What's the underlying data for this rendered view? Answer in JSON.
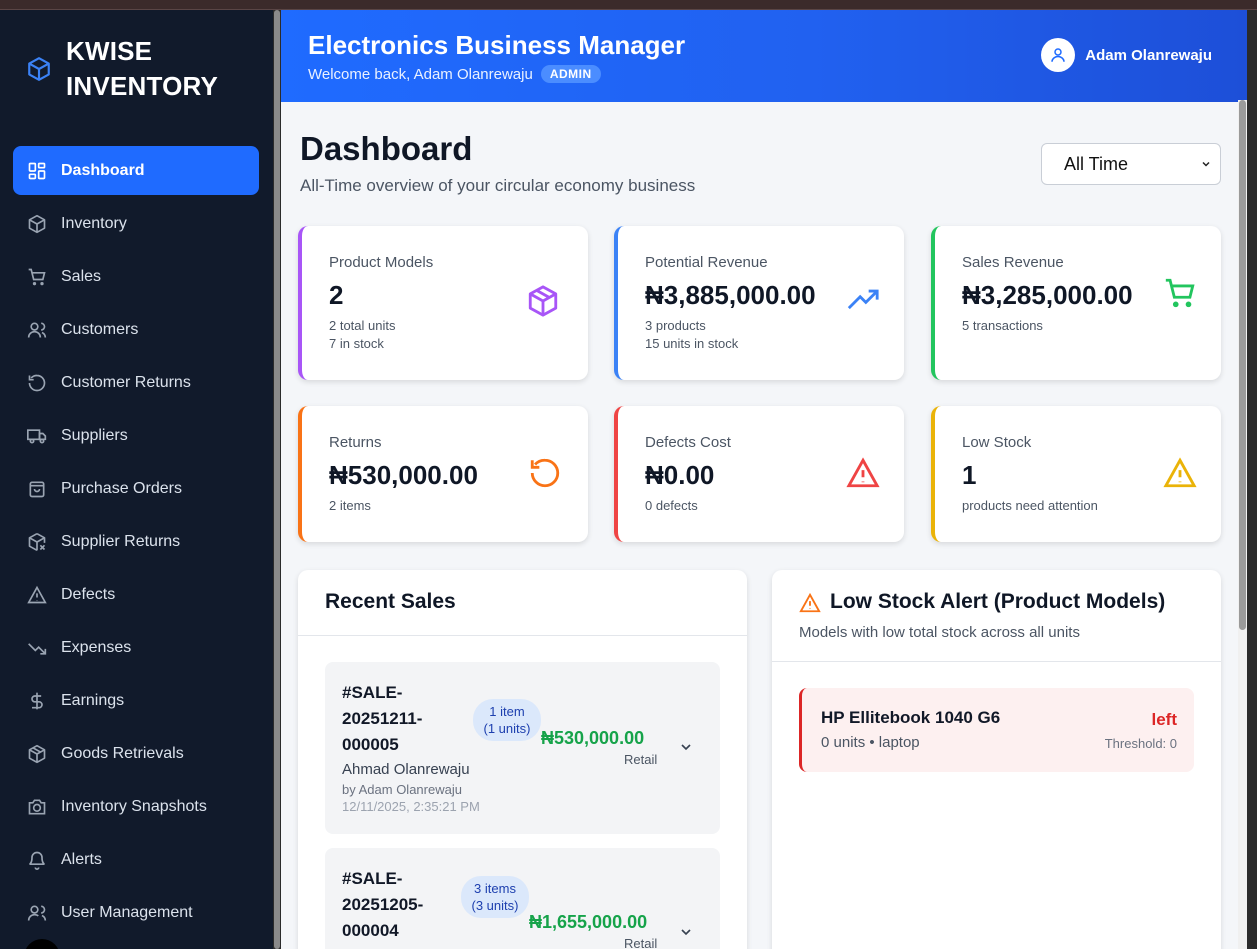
{
  "brand": {
    "name": "KWISE INVENTORY"
  },
  "sidebar": {
    "items": [
      {
        "label": "Dashboard",
        "icon": "dashboard-icon",
        "active": true
      },
      {
        "label": "Inventory",
        "icon": "package-icon"
      },
      {
        "label": "Sales",
        "icon": "cart-icon"
      },
      {
        "label": "Customers",
        "icon": "users-icon"
      },
      {
        "label": "Customer Returns",
        "icon": "rotate-ccw-icon"
      },
      {
        "label": "Suppliers",
        "icon": "truck-icon"
      },
      {
        "label": "Purchase Orders",
        "icon": "shopping-bag-icon"
      },
      {
        "label": "Supplier Returns",
        "icon": "package-x-icon"
      },
      {
        "label": "Defects",
        "icon": "alert-triangle-icon"
      },
      {
        "label": "Expenses",
        "icon": "trending-down-icon"
      },
      {
        "label": "Earnings",
        "icon": "dollar-icon"
      },
      {
        "label": "Goods Retrievals",
        "icon": "package-check-icon"
      },
      {
        "label": "Inventory Snapshots",
        "icon": "camera-icon"
      },
      {
        "label": "Alerts",
        "icon": "bell-icon"
      },
      {
        "label": "User Management",
        "icon": "users-cog-icon"
      }
    ]
  },
  "header": {
    "title": "Electronics Business Manager",
    "welcome": "Welcome back, Adam Olanrewaju",
    "role_badge": "ADMIN",
    "user_name": "Adam Olanrewaju"
  },
  "page": {
    "title": "Dashboard",
    "subtitle": "All-Time overview of your circular economy business",
    "time_filter": "All Time"
  },
  "stats": [
    {
      "label": "Product Models",
      "value": "2",
      "sub1": "2 total units",
      "sub2": "7 in stock",
      "color": "#a855f7",
      "icon": "package-icon"
    },
    {
      "label": "Potential Revenue",
      "value": "₦3,885,000.00",
      "sub1": "3 products",
      "sub2": "15 units in stock",
      "color": "#3b82f6",
      "icon": "trending-up-icon"
    },
    {
      "label": "Sales Revenue",
      "value": "₦3,285,000.00",
      "sub1": "5 transactions",
      "sub2": "",
      "color": "#22c55e",
      "icon": "cart-icon"
    },
    {
      "label": "Returns",
      "value": "₦530,000.00",
      "sub1": "2 items",
      "sub2": "",
      "color": "#f97316",
      "icon": "rotate-ccw-icon"
    },
    {
      "label": "Defects Cost",
      "value": "₦0.00",
      "sub1": "0 defects",
      "sub2": "",
      "color": "#ef4444",
      "icon": "alert-triangle-icon"
    },
    {
      "label": "Low Stock",
      "value": "1",
      "sub1": "products need attention",
      "sub2": "",
      "color": "#eab308",
      "icon": "alert-triangle-icon"
    }
  ],
  "recent_sales": {
    "title": "Recent Sales",
    "items": [
      {
        "id": "#SALE-20251211-000005",
        "items_pill": "1 item (1 units)",
        "amount": "₦530,000.00",
        "type": "Retail",
        "customer": "Ahmad Olanrewaju",
        "by": "by Adam Olanrewaju",
        "date": "12/11/2025, 2:35:21 PM"
      },
      {
        "id": "#SALE-20251205-000004",
        "items_pill": "3 items (3 units)",
        "amount": "₦1,655,000.00",
        "type": "Retail"
      }
    ]
  },
  "low_stock": {
    "title": "Low Stock Alert (Product Models)",
    "subtitle": "Models with low total stock across all units",
    "items": [
      {
        "name": "HP Ellitebook 1040 G6",
        "meta": "0 units • laptop",
        "status": "left",
        "threshold": "Threshold: 0"
      }
    ]
  }
}
